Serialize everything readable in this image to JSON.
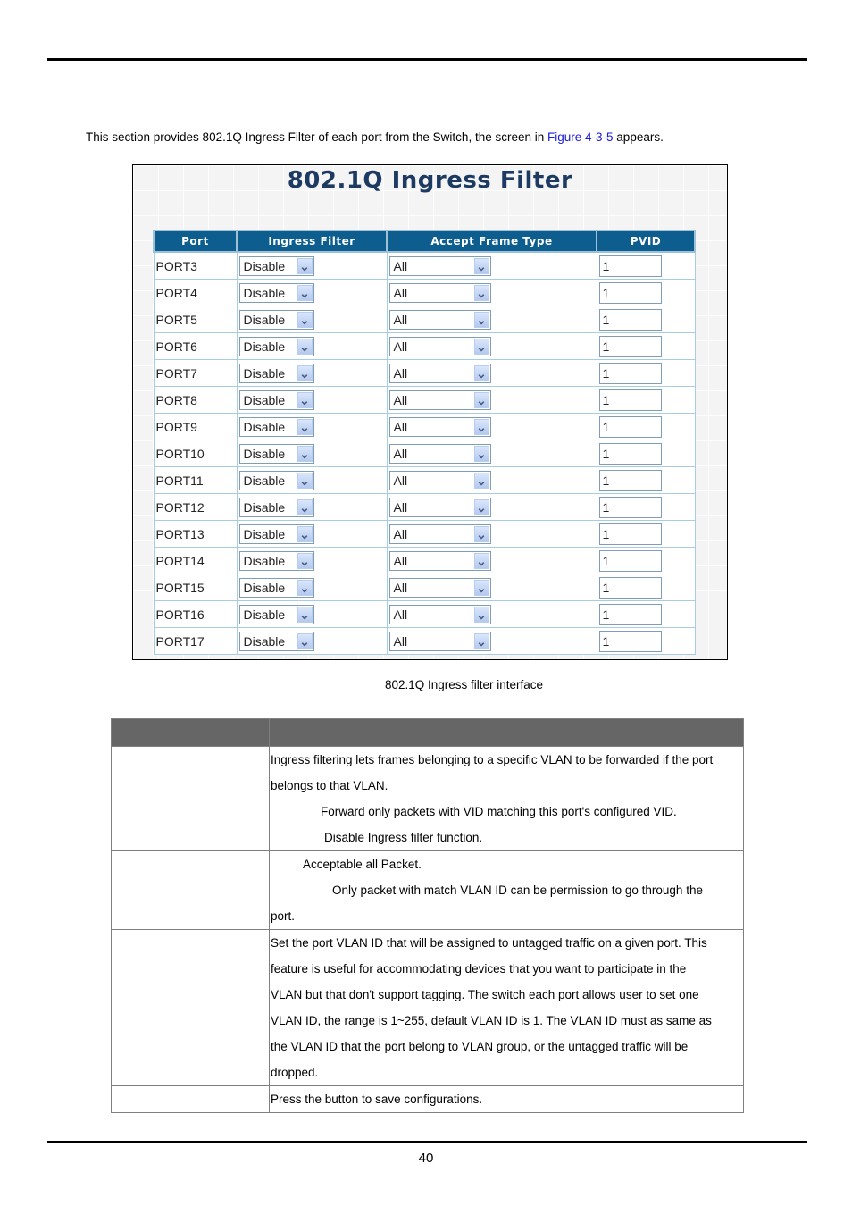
{
  "intro": {
    "text_before": "This section provides 802.1Q Ingress Filter of each port from the Switch, the screen in ",
    "link": "Figure 4-3-5",
    "text_after": " appears."
  },
  "screenshot": {
    "title": "802.1Q Ingress Filter",
    "columns": [
      "Port",
      "Ingress Filter",
      "Accept Frame Type",
      "PVID"
    ],
    "rows": [
      {
        "port": "PORT3",
        "ingress": "Disable",
        "frame": "All",
        "pvid": "1"
      },
      {
        "port": "PORT4",
        "ingress": "Disable",
        "frame": "All",
        "pvid": "1"
      },
      {
        "port": "PORT5",
        "ingress": "Disable",
        "frame": "All",
        "pvid": "1"
      },
      {
        "port": "PORT6",
        "ingress": "Disable",
        "frame": "All",
        "pvid": "1"
      },
      {
        "port": "PORT7",
        "ingress": "Disable",
        "frame": "All",
        "pvid": "1"
      },
      {
        "port": "PORT8",
        "ingress": "Disable",
        "frame": "All",
        "pvid": "1"
      },
      {
        "port": "PORT9",
        "ingress": "Disable",
        "frame": "All",
        "pvid": "1"
      },
      {
        "port": "PORT10",
        "ingress": "Disable",
        "frame": "All",
        "pvid": "1"
      },
      {
        "port": "PORT11",
        "ingress": "Disable",
        "frame": "All",
        "pvid": "1"
      },
      {
        "port": "PORT12",
        "ingress": "Disable",
        "frame": "All",
        "pvid": "1"
      },
      {
        "port": "PORT13",
        "ingress": "Disable",
        "frame": "All",
        "pvid": "1"
      },
      {
        "port": "PORT14",
        "ingress": "Disable",
        "frame": "All",
        "pvid": "1"
      },
      {
        "port": "PORT15",
        "ingress": "Disable",
        "frame": "All",
        "pvid": "1"
      },
      {
        "port": "PORT16",
        "ingress": "Disable",
        "frame": "All",
        "pvid": "1"
      },
      {
        "port": "PORT17",
        "ingress": "Disable",
        "frame": "All",
        "pvid": "1"
      }
    ]
  },
  "caption": "802.1Q Ingress filter interface",
  "desc_table": {
    "header": [
      "",
      ""
    ],
    "rows": [
      {
        "object": "",
        "lines": [
          "Ingress filtering lets frames belonging to a specific VLAN to be forwarded if the port",
          "belongs to that VLAN.",
          "Forward only packets with VID matching this port's configured VID.",
          "Disable Ingress filter function."
        ]
      },
      {
        "object": "",
        "lines": [
          "Acceptable all Packet.",
          "Only packet with match VLAN ID can be permission to go through the",
          "port."
        ]
      },
      {
        "object": "",
        "lines": [
          "Set the port VLAN ID that will be assigned to untagged traffic on a given port. This",
          "feature is useful for accommodating devices that you want to participate in the",
          "VLAN but that don't support tagging. The switch each port allows user to set one",
          "VLAN ID, the range is 1~255, default VLAN ID is 1. The VLAN ID must as same as",
          "the VLAN ID that the port belong to VLAN group, or the untagged traffic will be",
          "dropped."
        ]
      },
      {
        "object": "",
        "lines": [
          "Press the button to save configurations."
        ]
      }
    ]
  },
  "page_number": "40",
  "colors": {
    "link": "#1a1ad6",
    "header_bg": "#0d5d8f",
    "desc_header_bg": "#666666"
  }
}
